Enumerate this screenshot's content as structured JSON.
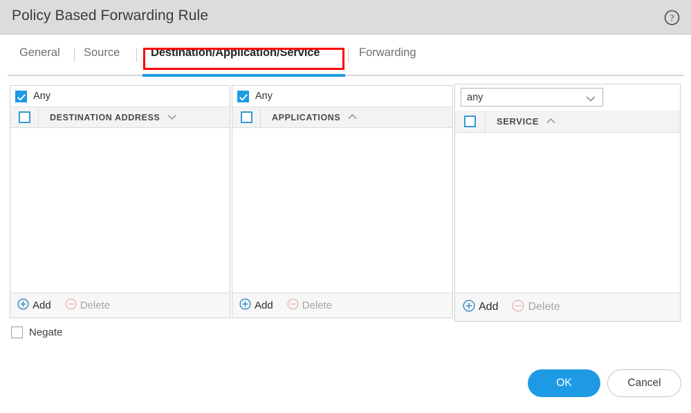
{
  "window": {
    "title": "Policy Based Forwarding Rule",
    "help_icon": "help-circle-icon"
  },
  "tabs": {
    "items": [
      {
        "label": "General",
        "active": false
      },
      {
        "label": "Source",
        "active": false
      },
      {
        "label": "Destination/Application/Service",
        "active": true
      },
      {
        "label": "Forwarding",
        "active": false
      }
    ],
    "active_label": "Destination/Application/Service",
    "annotation_color": "#fe0000",
    "active_underline_color": "#1e9ae5"
  },
  "panels": [
    {
      "any_label": "Any",
      "any_checked": true,
      "column_header": "DESTINATION ADDRESS",
      "header_checked": false,
      "sort_direction": "descending",
      "rows": [],
      "add_label": "Add",
      "delete_label": "Delete",
      "delete_disabled": true
    },
    {
      "any_label": "Any",
      "any_checked": true,
      "column_header": "APPLICATIONS",
      "header_checked": false,
      "sort_direction": "ascending",
      "rows": [],
      "add_label": "Add",
      "delete_label": "Delete",
      "delete_disabled": true
    },
    {
      "select_value": "any",
      "select_options": [
        "any"
      ],
      "column_header": "SERVICE",
      "header_checked": false,
      "sort_direction": "ascending",
      "rows": [],
      "add_label": "Add",
      "delete_label": "Delete",
      "delete_disabled": true
    }
  ],
  "negate": {
    "label": "Negate",
    "checked": false
  },
  "footer": {
    "ok_label": "OK",
    "cancel_label": "Cancel",
    "ok_color": "#1e9ae5"
  }
}
